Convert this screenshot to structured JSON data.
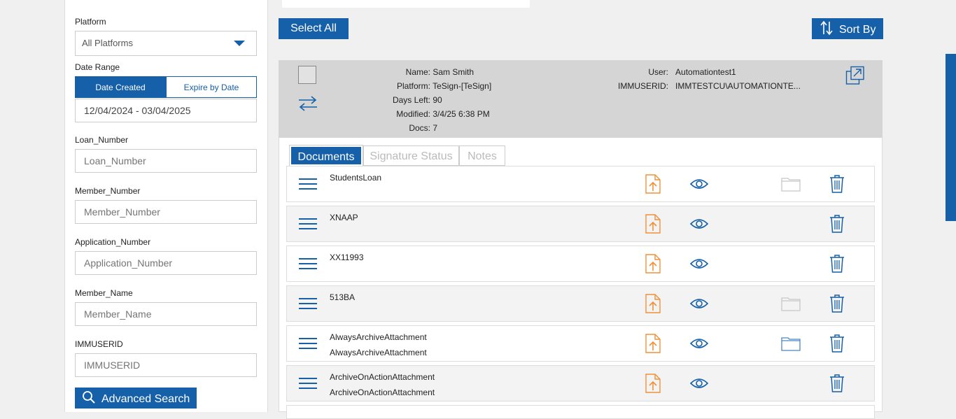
{
  "sidebar": {
    "platform_label": "Platform",
    "platform_value": "All Platforms",
    "date_range_label": "Date Range",
    "date_created": "Date Created",
    "expire_by_date": "Expire by Date",
    "date_range_value": "12/04/2024 - 03/04/2025",
    "loan_number_label": "Loan_Number",
    "loan_number_placeholder": "Loan_Number",
    "member_number_label": "Member_Number",
    "member_number_placeholder": "Member_Number",
    "application_number_label": "Application_Number",
    "application_number_placeholder": "Application_Number",
    "member_name_label": "Member_Name",
    "member_name_placeholder": "Member_Name",
    "immuserid_label": "IMMUSERID",
    "immuserid_placeholder": "IMMUSERID",
    "advanced_search": "Advanced Search"
  },
  "toolbar": {
    "select_all": "Select All",
    "sort_by": "Sort By"
  },
  "package": {
    "name_key": "Name:",
    "name": "Sam Smith",
    "platform_key": "Platform:",
    "platform": "TeSign-[TeSign]",
    "days_left_key": "Days Left:",
    "days_left": "90",
    "modified_key": "Modified:",
    "modified": "3/4/25 6:38 PM",
    "docs_key": "Docs:",
    "docs": "7",
    "user_key": "User:",
    "user": "Automationtest1",
    "immuserid_key": "IMMUSERID:",
    "immuserid": "IMMTESTCU\\AUTOMATIONTE..."
  },
  "tabs": {
    "documents": "Documents",
    "signature_status": "Signature Status",
    "notes": "Notes"
  },
  "documents": [
    {
      "line1": "StudentsLoan",
      "line2": "",
      "folder": "light"
    },
    {
      "line1": "XNAAP",
      "line2": "",
      "folder": "none"
    },
    {
      "line1": "XX11993",
      "line2": "",
      "folder": "none"
    },
    {
      "line1": "513BA",
      "line2": "",
      "folder": "light"
    },
    {
      "line1": "AlwaysArchiveAttachment",
      "line2": "AlwaysArchiveAttachment",
      "folder": "blue"
    },
    {
      "line1": "ArchiveOnActionAttachment",
      "line2": "ArchiveOnActionAttachment",
      "folder": "none"
    }
  ],
  "colors": {
    "primary": "#1560a8",
    "upload_icon": "#f0913a",
    "folder_light": "#c8c8c8",
    "folder_blue": "#4a86c0"
  },
  "icons": [
    "chevron-down-icon",
    "search-icon",
    "sort-icon",
    "swap-icon",
    "external-link-icon",
    "menu-icon",
    "upload-file-icon",
    "eye-icon",
    "folder-icon",
    "trash-icon"
  ]
}
